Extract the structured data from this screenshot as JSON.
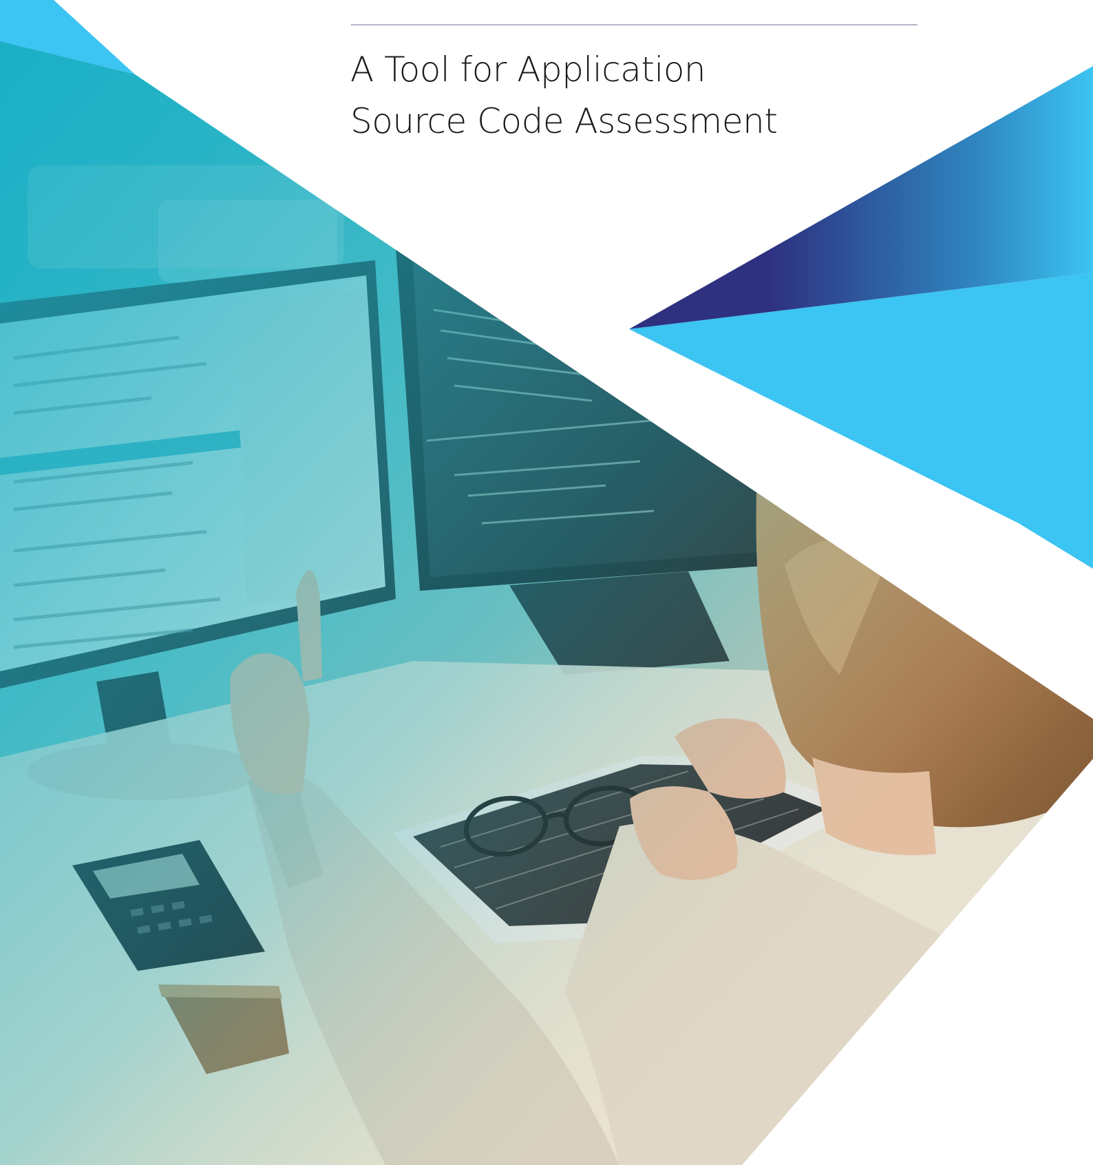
{
  "document": {
    "title_partial": "",
    "subtitle_lines": [
      "A Tool for Application",
      "Source Code Assessment"
    ]
  },
  "colors": {
    "light_blue": "#3cc4f2",
    "navy": "#2e3180",
    "teal": "#1bb0c8",
    "rule": "#b4b6c4",
    "text": "#1a1a1a"
  },
  "photo": {
    "subject_icon": "developer-at-monitors-photo"
  }
}
